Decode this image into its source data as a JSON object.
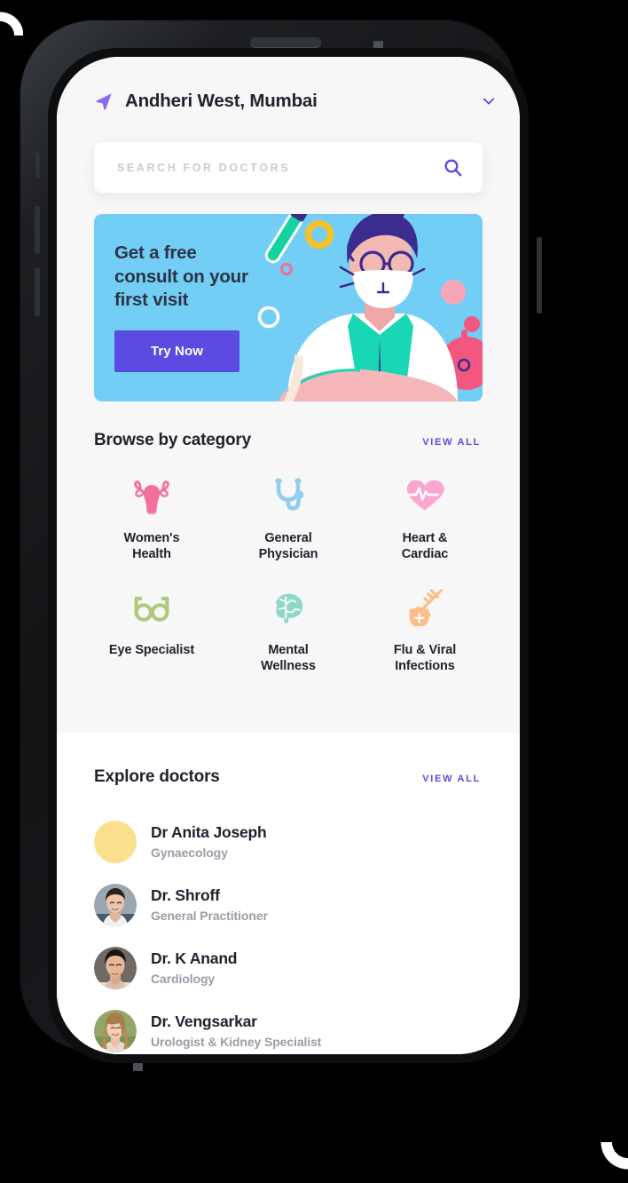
{
  "header": {
    "location": "Andheri West, Mumbai",
    "nav_icon": "navigation-arrow-icon",
    "chevron_icon": "chevron-down-icon"
  },
  "search": {
    "placeholder": "SEARCH FOR DOCTORS",
    "value": "",
    "icon": "search-icon"
  },
  "banner": {
    "title": "Get a free\nconsult on your\nfirst visit",
    "cta_label": "Try Now",
    "bg_color": "#72CEF4",
    "cta_color": "#5B4BE0"
  },
  "categories": {
    "title": "Browse by category",
    "view_all": "VIEW ALL",
    "items": [
      {
        "label": "Women's\nHealth",
        "icon": "uterus-icon",
        "color": "#F2709C"
      },
      {
        "label": "General\nPhysician",
        "icon": "stethoscope-icon",
        "color": "#90CDEE"
      },
      {
        "label": "Heart &\nCardiac",
        "icon": "heart-pulse-icon",
        "color": "#FBA6D1"
      },
      {
        "label": "Eye Specialist",
        "icon": "glasses-icon",
        "color": "#AFC97A"
      },
      {
        "label": "Mental\nWellness",
        "icon": "brain-icon",
        "color": "#8FD8C6"
      },
      {
        "label": "Flu & Viral\nInfections",
        "icon": "syringe-shield-icon",
        "color": "#FCBE86"
      }
    ]
  },
  "doctors": {
    "title": "Explore doctors",
    "view_all": "VIEW ALL",
    "items": [
      {
        "name": "Dr Anita Joseph",
        "specialty": "Gynaecology",
        "avatar": "plain-yellow-circle",
        "avatar_color": "#FAE08C"
      },
      {
        "name": "Dr. Shroff",
        "specialty": "General Practitioner",
        "avatar": "photo-male-1",
        "avatar_color": "#8a96a3"
      },
      {
        "name": "Dr. K Anand",
        "specialty": "Cardiology",
        "avatar": "photo-male-2",
        "avatar_color": "#4a4038"
      },
      {
        "name": "Dr. Vengsarkar",
        "specialty": "Urologist & Kidney Specialist",
        "avatar": "photo-female-1",
        "avatar_color": "#8ea06a"
      }
    ]
  },
  "accent_color": "#5B4BE0"
}
